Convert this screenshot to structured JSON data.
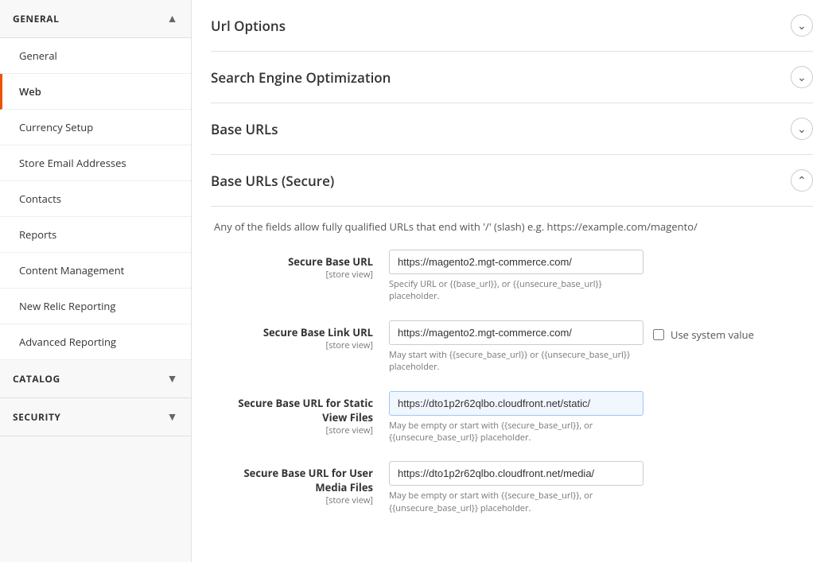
{
  "sidebar": {
    "sections": [
      {
        "id": "general",
        "label": "GENERAL",
        "expanded": true,
        "chevron": "▲",
        "items": [
          {
            "id": "general",
            "label": "General",
            "active": false
          },
          {
            "id": "web",
            "label": "Web",
            "active": true
          },
          {
            "id": "currency-setup",
            "label": "Currency Setup",
            "active": false
          },
          {
            "id": "store-email",
            "label": "Store Email Addresses",
            "active": false
          },
          {
            "id": "contacts",
            "label": "Contacts",
            "active": false
          },
          {
            "id": "reports",
            "label": "Reports",
            "active": false
          },
          {
            "id": "content-management",
            "label": "Content Management",
            "active": false
          },
          {
            "id": "new-relic",
            "label": "New Relic Reporting",
            "active": false
          },
          {
            "id": "advanced-reporting",
            "label": "Advanced Reporting",
            "active": false
          }
        ]
      },
      {
        "id": "catalog",
        "label": "CATALOG",
        "expanded": false,
        "chevron": "▼",
        "items": []
      },
      {
        "id": "security",
        "label": "SECURITY",
        "expanded": false,
        "chevron": "▼",
        "items": []
      }
    ]
  },
  "main": {
    "sections": [
      {
        "id": "url-options",
        "title": "Url Options",
        "expanded": false,
        "chevron_open": "⊙",
        "chevron_closed": "⊙"
      },
      {
        "id": "seo",
        "title": "Search Engine Optimization",
        "expanded": false
      },
      {
        "id": "base-urls",
        "title": "Base URLs",
        "expanded": false
      },
      {
        "id": "base-urls-secure",
        "title": "Base URLs (Secure)",
        "expanded": true
      }
    ],
    "base_urls_secure": {
      "description": "Any of the fields allow fully qualified URLs that end with '/' (slash) e.g. https://example.com/magento/",
      "fields": [
        {
          "id": "secure-base-url",
          "label": "Secure Base URL",
          "sub_label": "[store view]",
          "value": "https://magento2.mgt-commerce.com/",
          "help": "Specify URL or {{base_url}}, or {{unsecure_base_url}} placeholder.",
          "highlighted": false,
          "show_system_value": false
        },
        {
          "id": "secure-base-link-url",
          "label": "Secure Base Link URL",
          "sub_label": "[store view]",
          "value": "https://magento2.mgt-commerce.com/",
          "help": "May start with {{secure_base_url}} or {{unsecure_base_url}} placeholder.",
          "highlighted": false,
          "show_system_value": true,
          "system_value_label": "Use system value"
        },
        {
          "id": "secure-base-url-static",
          "label": "Secure Base URL for Static View Files",
          "sub_label": "[store view]",
          "value": "https://dto1p2r62qlbo.cloudfront.net/static/",
          "help": "May be empty or start with {{secure_base_url}}, or {{unsecure_base_url}} placeholder.",
          "highlighted": true,
          "show_system_value": false
        },
        {
          "id": "secure-base-url-media",
          "label": "Secure Base URL for User Media Files",
          "sub_label": "[store view]",
          "value": "https://dto1p2r62qlbo.cloudfront.net/media/",
          "help": "May be empty or start with {{secure_base_url}}, or {{unsecure_base_url}} placeholder.",
          "highlighted": false,
          "show_system_value": false
        }
      ]
    }
  }
}
